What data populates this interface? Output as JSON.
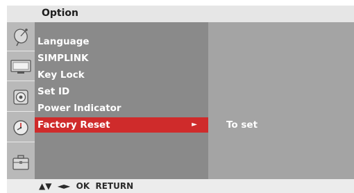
{
  "header": {
    "title": "Option"
  },
  "icons": [
    "satellite-dish-icon",
    "tv-screen-icon",
    "speaker-icon",
    "clock-icon",
    "toolbox-icon"
  ],
  "menu": {
    "items": [
      {
        "label": "Language"
      },
      {
        "label": "SIMPLINK"
      },
      {
        "label": "Key Lock"
      },
      {
        "label": "Set ID"
      },
      {
        "label": "Power Indicator"
      },
      {
        "label": "Factory Reset",
        "selected": true,
        "arrow": "►"
      }
    ]
  },
  "submenu": {
    "text": "To set"
  },
  "footer": {
    "nav": "▲▼  ◄►  OK  RETURN"
  },
  "colors": {
    "selection": "#cf2b2b",
    "menu_bg": "#8a8a8a",
    "submenu_bg": "#a4a4a4"
  }
}
